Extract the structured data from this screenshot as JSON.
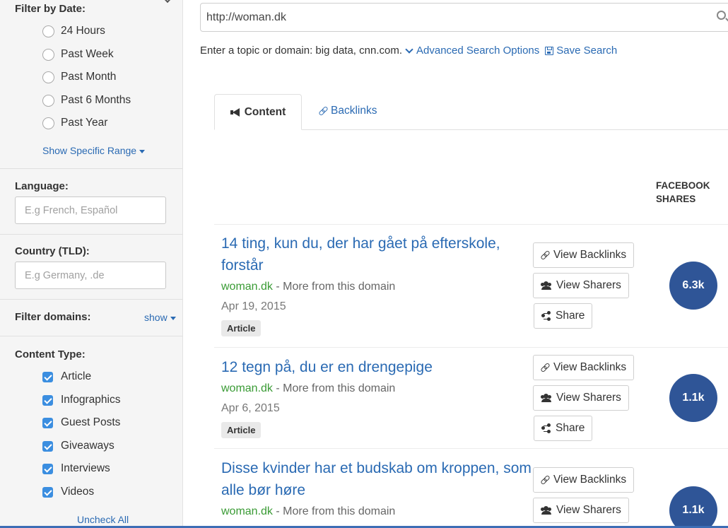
{
  "sidebar": {
    "date_filter": {
      "title": "Filter by Date:",
      "options": [
        "24 Hours",
        "Past Week",
        "Past Month",
        "Past 6 Months",
        "Past Year"
      ],
      "range_link": "Show Specific Range"
    },
    "language": {
      "title": "Language:",
      "placeholder": "E.g French, Español"
    },
    "country": {
      "title": "Country (TLD):",
      "placeholder": "E.g Germany, .de"
    },
    "filter_domains": {
      "title": "Filter domains:",
      "toggle": "show"
    },
    "content_type": {
      "title": "Content Type:",
      "options": [
        "Article",
        "Infographics",
        "Guest Posts",
        "Giveaways",
        "Interviews",
        "Videos"
      ],
      "uncheck_all": "Uncheck All"
    }
  },
  "search": {
    "value": "http://woman.dk",
    "hint": "Enter a topic or domain: big data, cnn.com.",
    "advanced_link": "Advanced Search Options",
    "save_link": "Save Search"
  },
  "tabs": {
    "content": "Content",
    "backlinks": "Backlinks"
  },
  "table": {
    "col_header": "FACEBOOK SHARES"
  },
  "buttons": {
    "view_backlinks": "View Backlinks",
    "view_sharers": "View Sharers",
    "share": "Share"
  },
  "results": [
    {
      "title": "14 ting, kun du, der har gået på efterskole, forstår",
      "domain": "woman.dk",
      "more": " - More from this domain",
      "date": "Apr 19, 2015",
      "type": "Article",
      "shares": "6.3k"
    },
    {
      "title": "12 tegn på, du er en drengepige",
      "domain": "woman.dk",
      "more": " - More from this domain",
      "date": "Apr 6, 2015",
      "type": "Article",
      "shares": "1.1k"
    },
    {
      "title": "Disse kvinder har et budskab om kroppen, som alle bør høre",
      "domain": "woman.dk",
      "more": " - More from this domain",
      "shares": "1.1k"
    }
  ]
}
